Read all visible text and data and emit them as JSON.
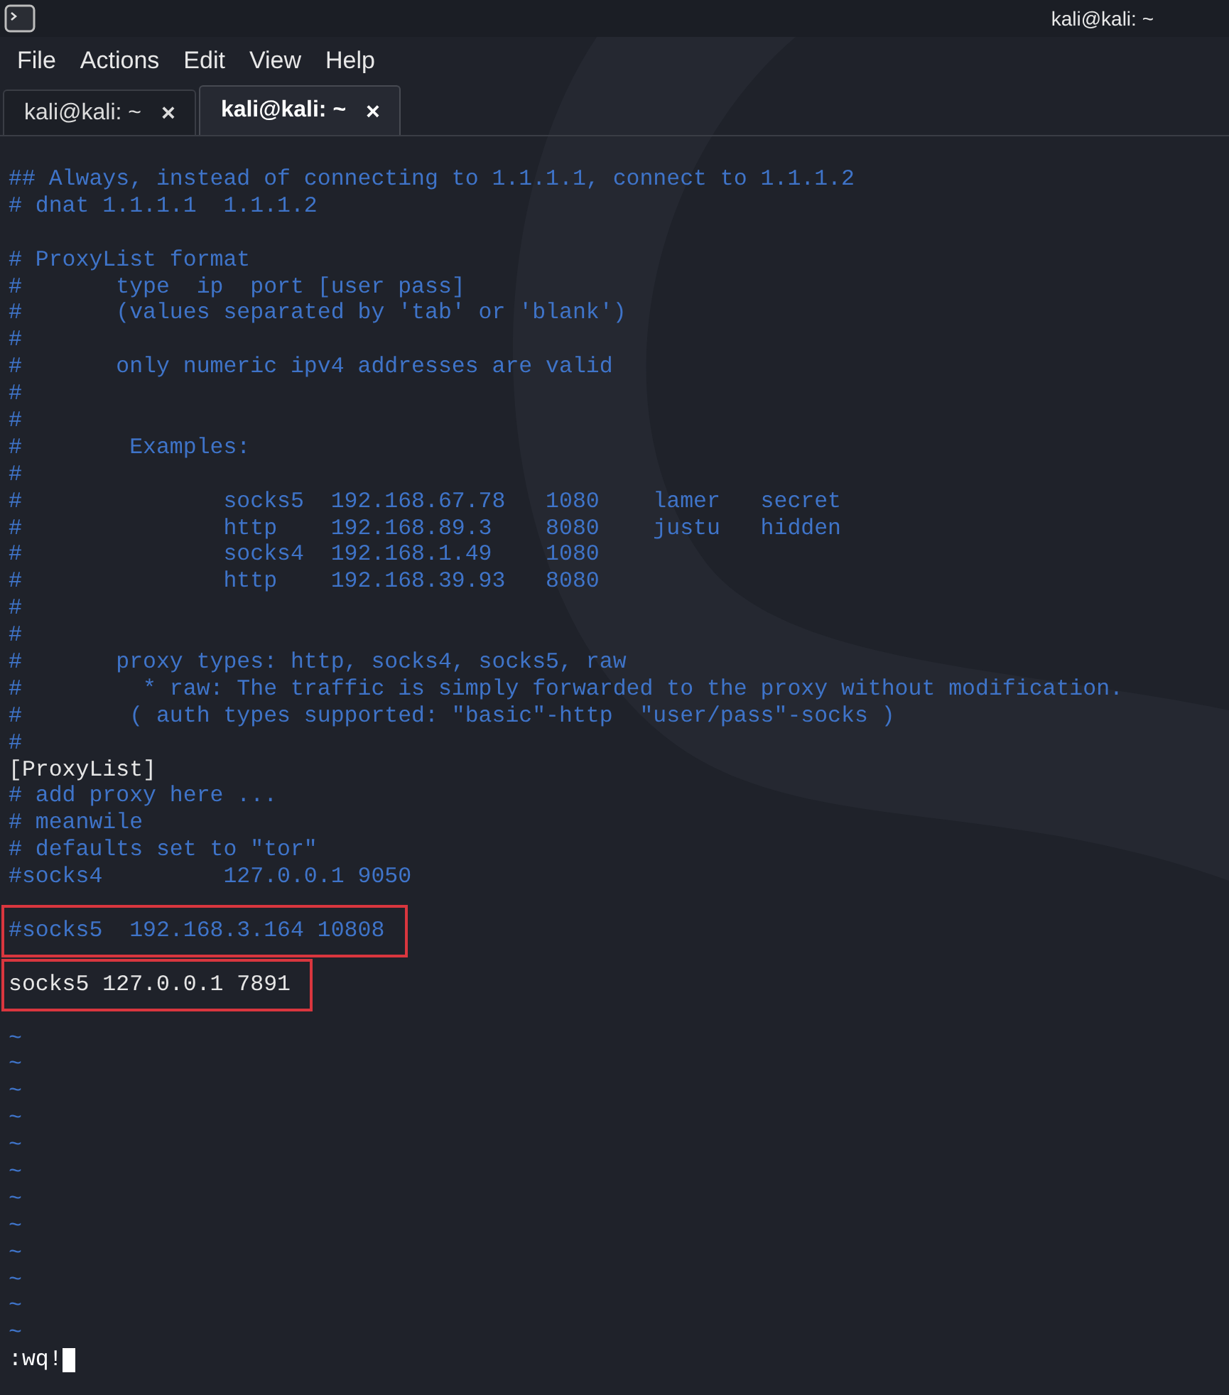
{
  "window": {
    "title": "kali@kali: ~"
  },
  "menu": [
    "File",
    "Actions",
    "Edit",
    "View",
    "Help"
  ],
  "tabs": [
    {
      "label": "kali@kali: ~",
      "close": "×",
      "selected": false
    },
    {
      "label": "kali@kali: ~",
      "close": "×",
      "selected": true
    }
  ],
  "editor": {
    "lines": [
      {
        "kind": "comment",
        "text": "## Always, instead of connecting to 1.1.1.1, connect to 1.1.1.2",
        "highlighted": false
      },
      {
        "kind": "comment",
        "text": "# dnat 1.1.1.1  1.1.1.2",
        "highlighted": false
      },
      {
        "kind": "blank"
      },
      {
        "kind": "comment",
        "text": "# ProxyList format",
        "highlighted": false
      },
      {
        "kind": "comment",
        "text": "#       type  ip  port [user pass]",
        "highlighted": false
      },
      {
        "kind": "comment",
        "text": "#       (values separated by 'tab' or 'blank')",
        "highlighted": false
      },
      {
        "kind": "comment",
        "text": "#",
        "highlighted": false
      },
      {
        "kind": "comment",
        "text": "#       only numeric ipv4 addresses are valid",
        "highlighted": false
      },
      {
        "kind": "comment",
        "text": "#",
        "highlighted": false
      },
      {
        "kind": "comment",
        "text": "#",
        "highlighted": false
      },
      {
        "kind": "comment",
        "text": "#        Examples:",
        "highlighted": false
      },
      {
        "kind": "comment",
        "text": "#",
        "highlighted": false
      },
      {
        "kind": "comment",
        "text": "#               socks5  192.168.67.78   1080    lamer   secret",
        "highlighted": false
      },
      {
        "kind": "comment",
        "text": "#               http    192.168.89.3    8080    justu   hidden",
        "highlighted": false
      },
      {
        "kind": "comment",
        "text": "#               socks4  192.168.1.49    1080",
        "highlighted": false
      },
      {
        "kind": "comment",
        "text": "#               http    192.168.39.93   8080",
        "highlighted": false
      },
      {
        "kind": "comment",
        "text": "#",
        "highlighted": false
      },
      {
        "kind": "comment",
        "text": "#",
        "highlighted": false
      },
      {
        "kind": "comment",
        "text": "#       proxy types: http, socks4, socks5, raw",
        "highlighted": false
      },
      {
        "kind": "comment",
        "text": "#         * raw: The traffic is simply forwarded to the proxy without modification.",
        "highlighted": false
      },
      {
        "kind": "comment",
        "text": "#        ( auth types supported: \"basic\"-http  \"user/pass\"-socks )",
        "highlighted": false
      },
      {
        "kind": "comment",
        "text": "#",
        "highlighted": false
      },
      {
        "kind": "text",
        "text": "[ProxyList]",
        "highlighted": false
      },
      {
        "kind": "comment",
        "text": "# add proxy here ...",
        "highlighted": false
      },
      {
        "kind": "comment",
        "text": "# meanwile",
        "highlighted": false
      },
      {
        "kind": "comment",
        "text": "# defaults set to \"tor\"",
        "highlighted": false
      },
      {
        "kind": "comment",
        "text": "#socks4         127.0.0.1 9050",
        "highlighted": false
      },
      {
        "kind": "blank"
      },
      {
        "kind": "comment",
        "text": "#socks5  192.168.3.164 10808",
        "highlighted": true
      },
      {
        "kind": "blank"
      },
      {
        "kind": "text",
        "text": "socks5 127.0.0.1 7891",
        "highlighted": true
      },
      {
        "kind": "blank"
      },
      {
        "kind": "tilde",
        "text": "~",
        "highlighted": false
      },
      {
        "kind": "tilde",
        "text": "~",
        "highlighted": false
      },
      {
        "kind": "tilde",
        "text": "~",
        "highlighted": false
      },
      {
        "kind": "tilde",
        "text": "~",
        "highlighted": false
      },
      {
        "kind": "tilde",
        "text": "~",
        "highlighted": false
      },
      {
        "kind": "tilde",
        "text": "~",
        "highlighted": false
      },
      {
        "kind": "tilde",
        "text": "~",
        "highlighted": false
      },
      {
        "kind": "tilde",
        "text": "~",
        "highlighted": false
      },
      {
        "kind": "tilde",
        "text": "~",
        "highlighted": false
      },
      {
        "kind": "tilde",
        "text": "~",
        "highlighted": false
      },
      {
        "kind": "tilde",
        "text": "~",
        "highlighted": false
      },
      {
        "kind": "tilde",
        "text": "~",
        "highlighted": false
      }
    ],
    "command": ":wq!"
  }
}
